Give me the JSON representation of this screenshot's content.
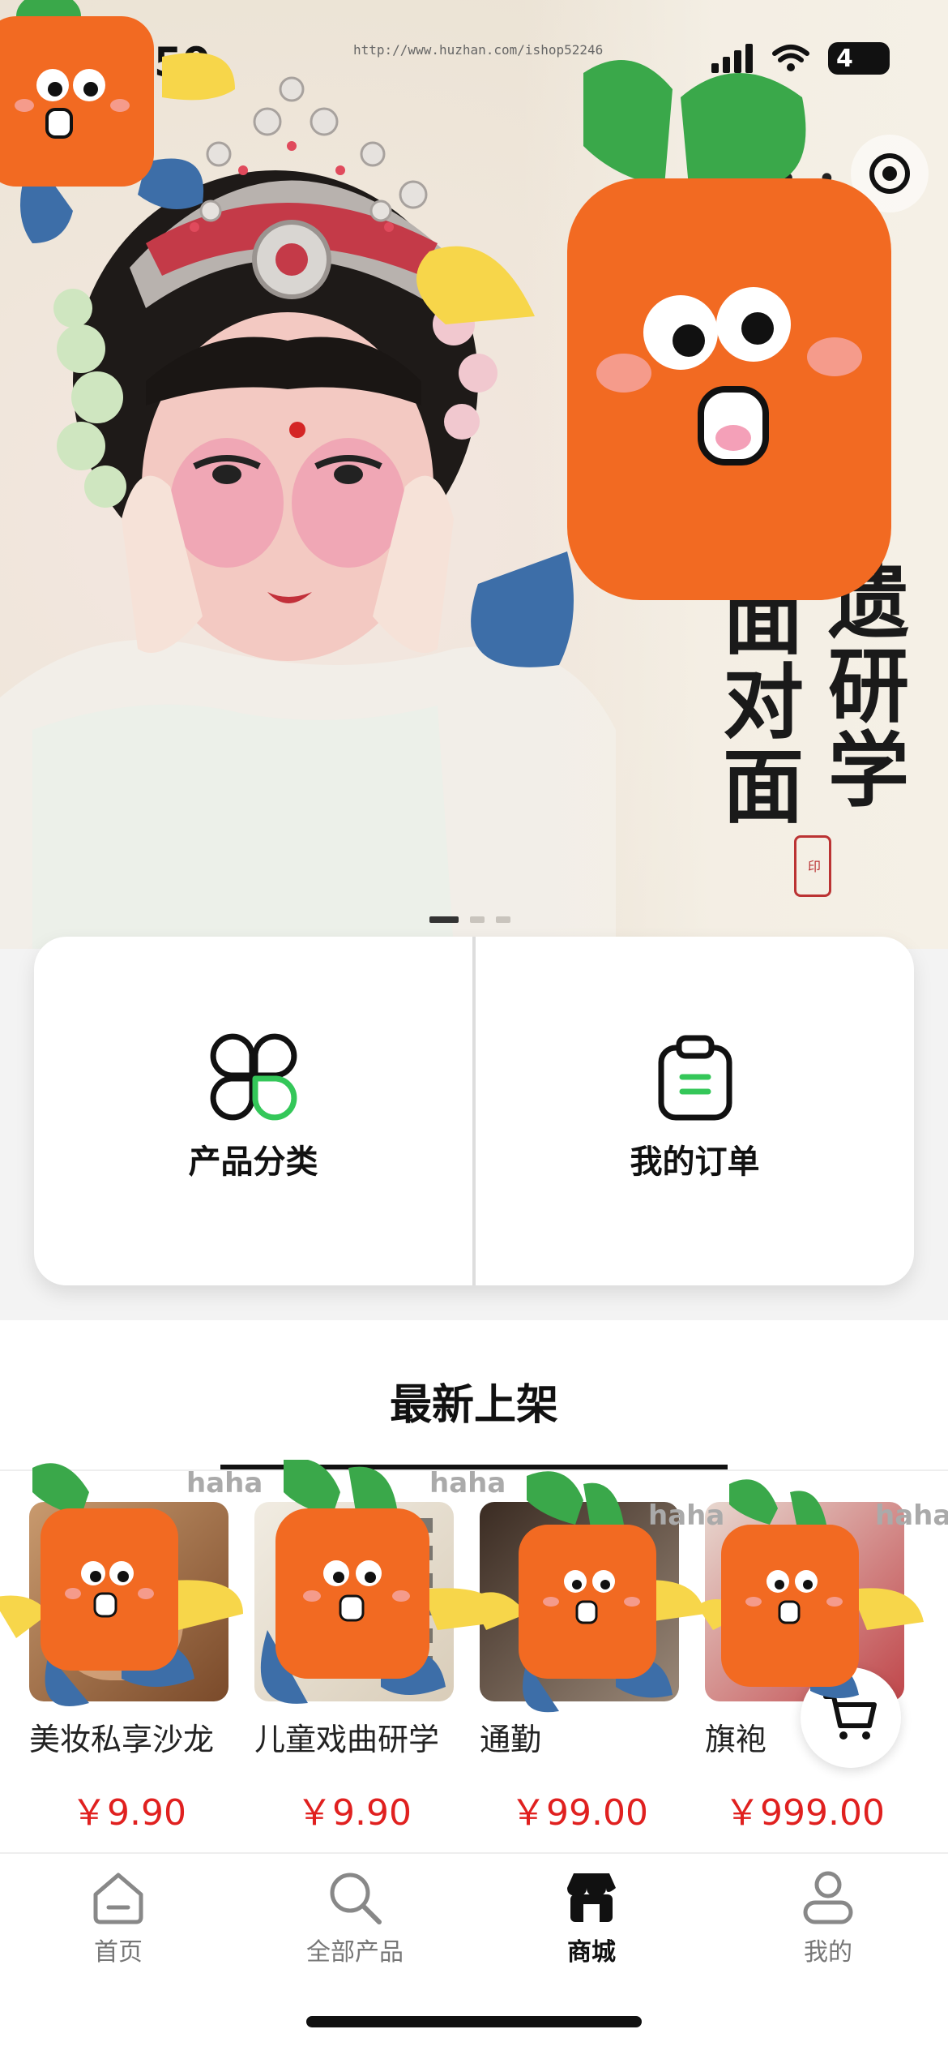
{
  "status_bar": {
    "time": "50",
    "url_watermark": "http://www.huzhan.com/ishop52246",
    "battery": "4"
  },
  "banner": {
    "side_chars": [
      "祥",
      "祥"
    ],
    "title_chars_col1": [
      "遗",
      "研",
      "学"
    ],
    "title_chars_col2": [
      "面",
      "对",
      "面"
    ],
    "seal_text": "印",
    "slide_count": 3,
    "active_slide": 1
  },
  "entries": [
    {
      "label": "产品分类",
      "icon": "clover-category-icon"
    },
    {
      "label": "我的订单",
      "icon": "clipboard-order-icon"
    }
  ],
  "new_arrivals": {
    "title": "最新上架",
    "products": [
      {
        "name": "美妆私享沙龙",
        "price": "￥9.90"
      },
      {
        "name": "儿童戏曲研学",
        "price": "￥9.90"
      },
      {
        "name": "通勤",
        "price": "￥99.00"
      },
      {
        "name": "旗袍",
        "price": "￥999.00"
      }
    ],
    "watermark": "haha"
  },
  "tabbar": {
    "items": [
      {
        "label": "首页",
        "icon": "home-icon"
      },
      {
        "label": "全部产品",
        "icon": "search-icon"
      },
      {
        "label": "商城",
        "icon": "store-icon"
      },
      {
        "label": "我的",
        "icon": "user-icon"
      }
    ],
    "active_index": 2
  },
  "colors": {
    "price": "#e0201f",
    "accent_green": "#34c759",
    "mascot_orange": "#f26a22",
    "mascot_green": "#3aa84a",
    "mascot_yellow": "#f7d64a",
    "mascot_blue": "#3d6ea8"
  }
}
